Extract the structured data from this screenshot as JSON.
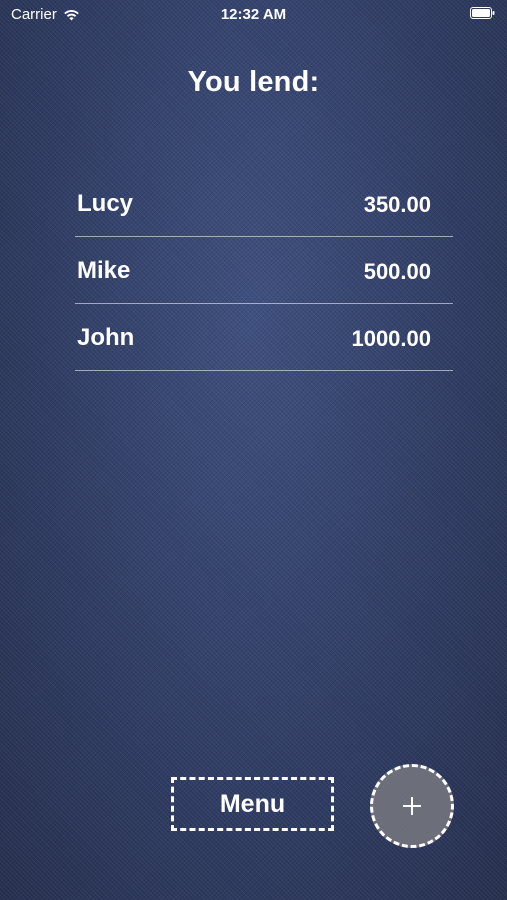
{
  "status_bar": {
    "carrier": "Carrier",
    "time": "12:32 AM",
    "wifi_icon": "wifi-icon",
    "battery_icon": "battery-icon"
  },
  "page": {
    "title": "You lend:"
  },
  "lend_list": [
    {
      "name": "Lucy",
      "amount": "350.00"
    },
    {
      "name": "Mike",
      "amount": "500.00"
    },
    {
      "name": "John",
      "amount": "1000.00"
    }
  ],
  "buttons": {
    "menu_label": "Menu",
    "add_icon": "plus-icon"
  },
  "colors": {
    "background": "#33416a",
    "text": "#ffffff",
    "add_button_fill": "#78787f"
  }
}
